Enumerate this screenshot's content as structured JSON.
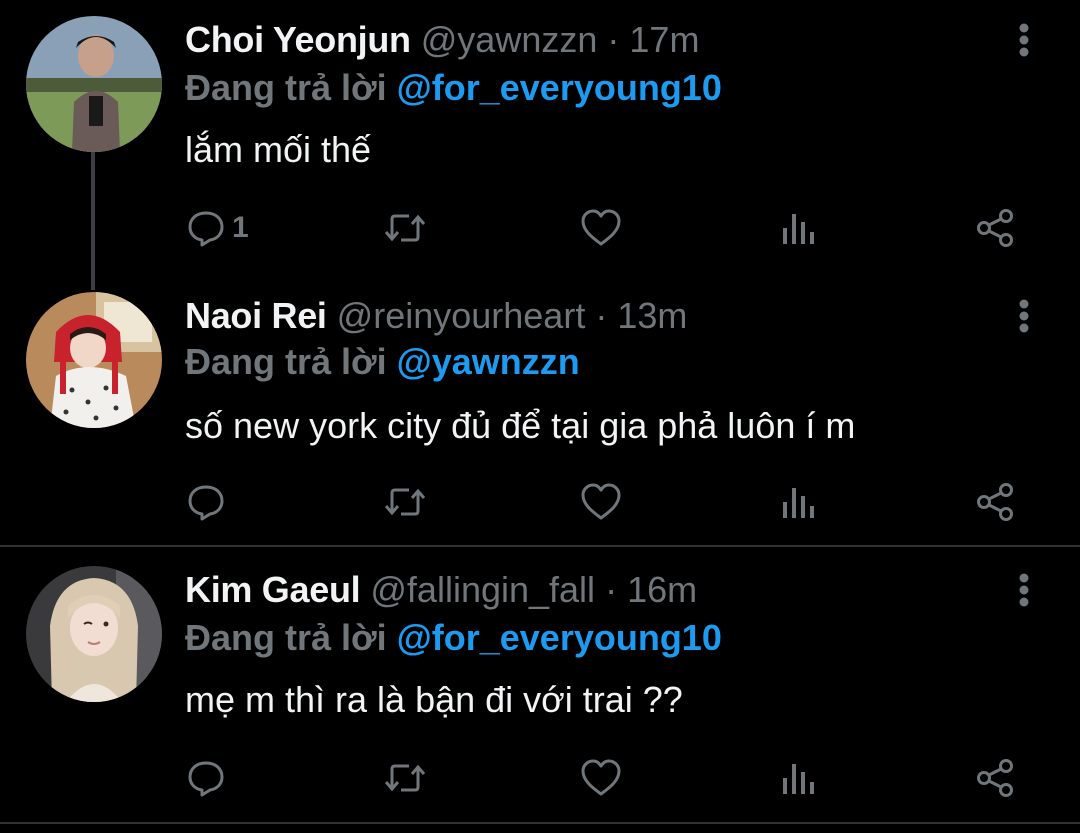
{
  "reply_prefix": "Đang trả lời",
  "colors": {
    "background": "#000000",
    "text_primary": "#f2f3f4",
    "text_secondary": "#71767b",
    "link": "#1d9bf0",
    "divider": "#2f3336"
  },
  "tweets": [
    {
      "display_name": "Choi Yeonjun",
      "handle": "@yawnzzn",
      "separator": "·",
      "time": "17m",
      "reply_to": "@for_everyoung10",
      "text": "lắm mối thế",
      "reply_count": "1",
      "avatar_icon": "user-avatar-photo"
    },
    {
      "display_name": "Naoi Rei",
      "handle": "@reinyourheart",
      "separator": "·",
      "time": "13m",
      "reply_to": "@yawnzzn",
      "text": "số new york city đủ để tại gia phả luôn í m",
      "reply_count": "",
      "avatar_icon": "user-avatar-photo"
    },
    {
      "display_name": "Kim Gaeul",
      "handle": "@fallingin_fall",
      "separator": "·",
      "time": "16m",
      "reply_to": "@for_everyoung10",
      "text": "mẹ m thì ra là bận đi với trai ??",
      "reply_count": "",
      "avatar_icon": "user-avatar-photo"
    }
  ],
  "action_icons": [
    "reply-icon",
    "retweet-icon",
    "like-icon",
    "analytics-icon",
    "share-icon"
  ]
}
